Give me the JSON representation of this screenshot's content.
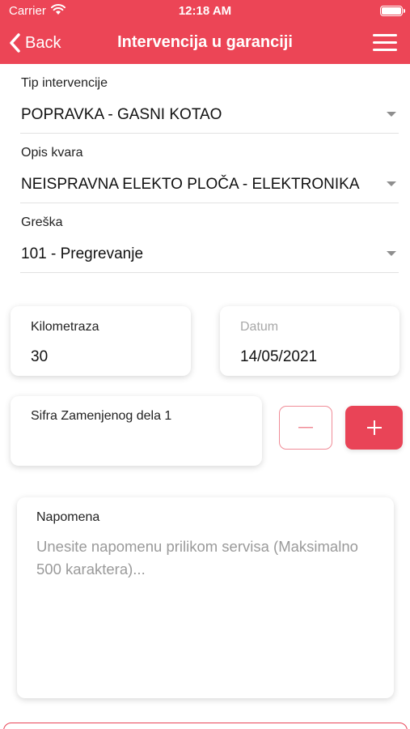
{
  "status_bar": {
    "carrier": "Carrier",
    "time": "12:18 AM"
  },
  "nav": {
    "back_label": "Back",
    "title": "Intervencija u garanciji",
    "menu_icon": "hamburger-menu-icon"
  },
  "form": {
    "tip_intervencije": {
      "label": "Tip intervencije",
      "value": "POPRAVKA - GASNI KOTAO"
    },
    "opis_kvara": {
      "label": "Opis kvara",
      "value": "NEISPRAVNA ELEKTO PLOČA - ELEKTRONIKA"
    },
    "greska": {
      "label": "Greška",
      "value": "101 - Pregrevanje"
    },
    "kilometraza": {
      "label": "Kilometraza",
      "value": "30"
    },
    "datum": {
      "label": "Datum",
      "value": "14/05/2021"
    },
    "sifra": {
      "label": "Sifra Zamenjenog dela 1",
      "value": ""
    },
    "napomena": {
      "label": "Napomena",
      "placeholder": "Unesite napomenu prilikom servisa (Maksimalno 500 karaktera)..."
    }
  },
  "stepper": {
    "minus_icon": "minus-icon",
    "plus_icon": "plus-icon"
  },
  "colors": {
    "accent": "#ec4556",
    "button": "#e94457",
    "minus_border": "#f08c97",
    "muted_text": "#a8a8a8"
  }
}
